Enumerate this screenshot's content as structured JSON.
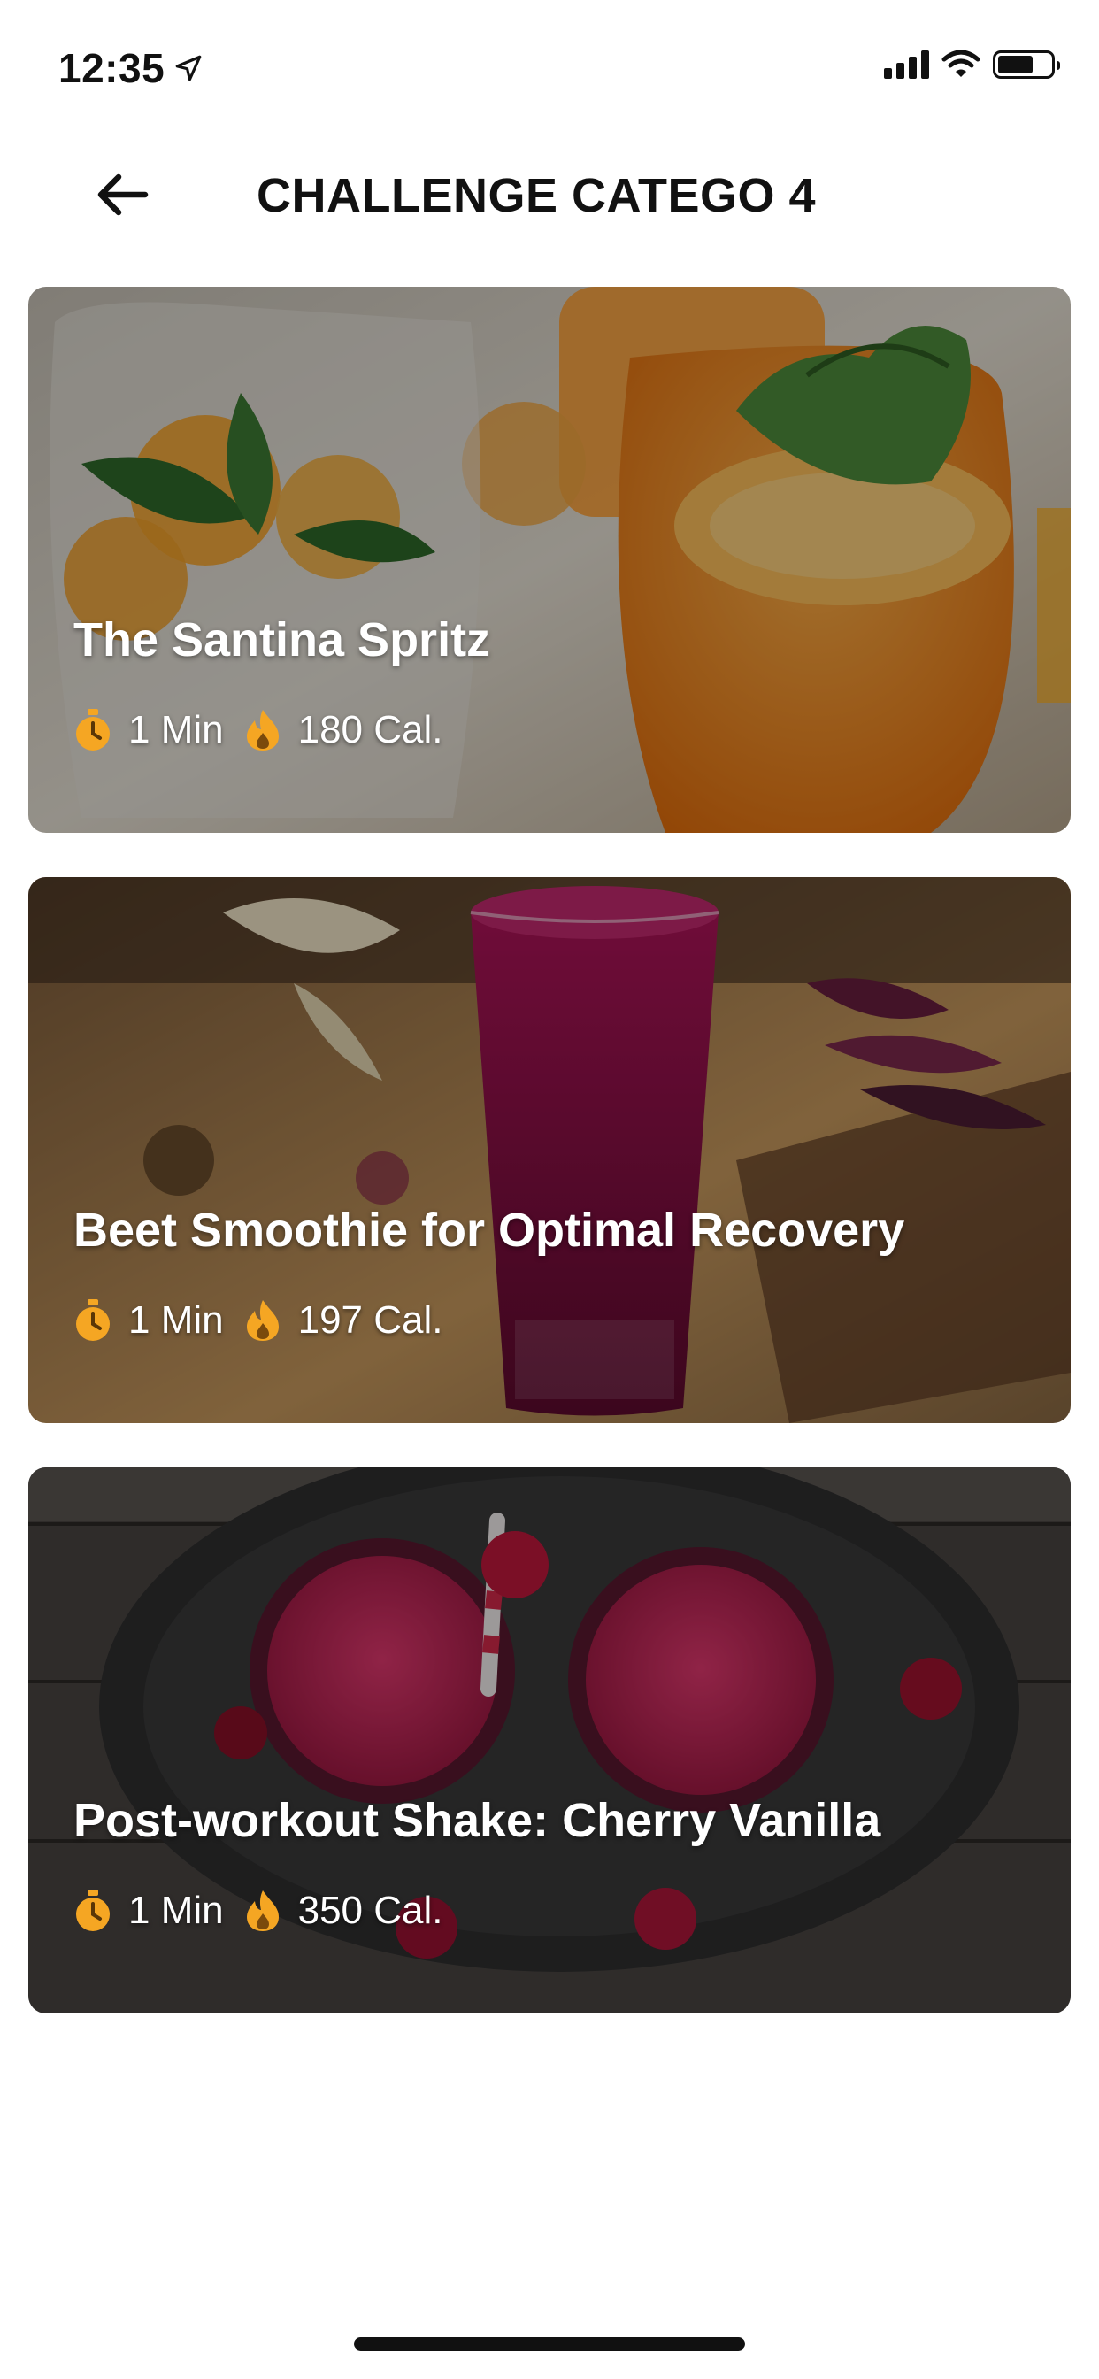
{
  "status_bar": {
    "time": "12:35"
  },
  "header": {
    "title": "CHALLENGE CATEGO 4"
  },
  "colors": {
    "accent": "#F5A623",
    "text": "#111111",
    "background": "#FFFFFF"
  },
  "icons": {
    "location": "location-arrow-icon",
    "timer": "stopwatch-icon",
    "calories": "flame-icon",
    "back": "arrow-left-icon"
  },
  "recipes": [
    {
      "title": "The Santina Spritz",
      "duration": "1 Min",
      "calories": "180 Cal."
    },
    {
      "title": "Beet Smoothie for Optimal Recovery",
      "duration": "1 Min",
      "calories": "197 Cal."
    },
    {
      "title": "Post-workout Shake: Cherry Vanilla",
      "duration": "1 Min",
      "calories": "350 Cal."
    }
  ]
}
